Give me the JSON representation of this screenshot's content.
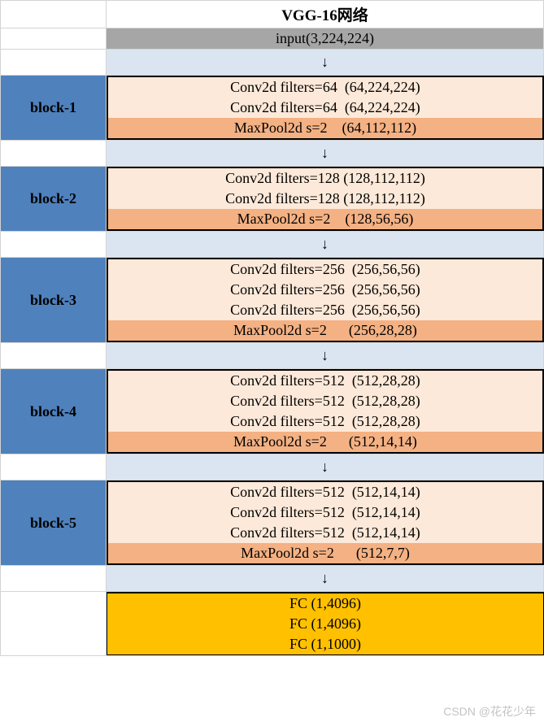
{
  "title": "VGG-16网络",
  "input": "input(3,224,224)",
  "arrow": "↓",
  "blocks": [
    {
      "label": "block-1",
      "convs": [
        "Conv2d filters=64  (64,224,224)",
        "Conv2d filters=64  (64,224,224)"
      ],
      "pool": "MaxPool2d s=2    (64,112,112)"
    },
    {
      "label": "block-2",
      "convs": [
        "Conv2d filters=128 (128,112,112)",
        "Conv2d filters=128 (128,112,112)"
      ],
      "pool": "MaxPool2d s=2    (128,56,56)"
    },
    {
      "label": "block-3",
      "convs": [
        "Conv2d filters=256  (256,56,56)",
        "Conv2d filters=256  (256,56,56)",
        "Conv2d filters=256  (256,56,56)"
      ],
      "pool": "MaxPool2d s=2      (256,28,28)"
    },
    {
      "label": "block-4",
      "convs": [
        "Conv2d filters=512  (512,28,28)",
        "Conv2d filters=512  (512,28,28)",
        "Conv2d filters=512  (512,28,28)"
      ],
      "pool": "MaxPool2d s=2      (512,14,14)"
    },
    {
      "label": "block-5",
      "convs": [
        "Conv2d filters=512  (512,14,14)",
        "Conv2d filters=512  (512,14,14)",
        "Conv2d filters=512  (512,14,14)"
      ],
      "pool": "MaxPool2d s=2      (512,7,7)"
    }
  ],
  "fc": [
    "FC (1,4096)",
    "FC (1,4096)",
    "FC (1,1000)"
  ],
  "watermark": "CSDN @花花少年",
  "chart_data": {
    "type": "table",
    "title": "VGG-16网络",
    "input_shape": [
      3,
      224,
      224
    ],
    "layers": [
      {
        "block": "block-1",
        "type": "Conv2d",
        "filters": 64,
        "output": [
          64,
          224,
          224
        ]
      },
      {
        "block": "block-1",
        "type": "Conv2d",
        "filters": 64,
        "output": [
          64,
          224,
          224
        ]
      },
      {
        "block": "block-1",
        "type": "MaxPool2d",
        "stride": 2,
        "output": [
          64,
          112,
          112
        ]
      },
      {
        "block": "block-2",
        "type": "Conv2d",
        "filters": 128,
        "output": [
          128,
          112,
          112
        ]
      },
      {
        "block": "block-2",
        "type": "Conv2d",
        "filters": 128,
        "output": [
          128,
          112,
          112
        ]
      },
      {
        "block": "block-2",
        "type": "MaxPool2d",
        "stride": 2,
        "output": [
          128,
          56,
          56
        ]
      },
      {
        "block": "block-3",
        "type": "Conv2d",
        "filters": 256,
        "output": [
          256,
          56,
          56
        ]
      },
      {
        "block": "block-3",
        "type": "Conv2d",
        "filters": 256,
        "output": [
          256,
          56,
          56
        ]
      },
      {
        "block": "block-3",
        "type": "Conv2d",
        "filters": 256,
        "output": [
          256,
          56,
          56
        ]
      },
      {
        "block": "block-3",
        "type": "MaxPool2d",
        "stride": 2,
        "output": [
          256,
          28,
          28
        ]
      },
      {
        "block": "block-4",
        "type": "Conv2d",
        "filters": 512,
        "output": [
          512,
          28,
          28
        ]
      },
      {
        "block": "block-4",
        "type": "Conv2d",
        "filters": 512,
        "output": [
          512,
          28,
          28
        ]
      },
      {
        "block": "block-4",
        "type": "Conv2d",
        "filters": 512,
        "output": [
          512,
          28,
          28
        ]
      },
      {
        "block": "block-4",
        "type": "MaxPool2d",
        "stride": 2,
        "output": [
          512,
          14,
          14
        ]
      },
      {
        "block": "block-5",
        "type": "Conv2d",
        "filters": 512,
        "output": [
          512,
          14,
          14
        ]
      },
      {
        "block": "block-5",
        "type": "Conv2d",
        "filters": 512,
        "output": [
          512,
          14,
          14
        ]
      },
      {
        "block": "block-5",
        "type": "Conv2d",
        "filters": 512,
        "output": [
          512,
          14,
          14
        ]
      },
      {
        "block": "block-5",
        "type": "MaxPool2d",
        "stride": 2,
        "output": [
          512,
          7,
          7
        ]
      },
      {
        "block": "fc",
        "type": "FC",
        "output": [
          1,
          4096
        ]
      },
      {
        "block": "fc",
        "type": "FC",
        "output": [
          1,
          4096
        ]
      },
      {
        "block": "fc",
        "type": "FC",
        "output": [
          1,
          1000
        ]
      }
    ]
  }
}
